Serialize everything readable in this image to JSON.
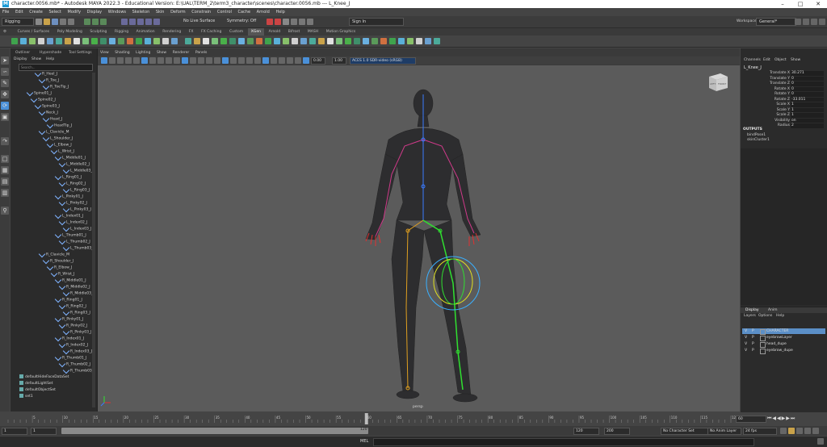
{
  "titlebar": {
    "title": "character.0056.mb* - Autodesk MAYA 2022.3 - Educational Version: E:\\UAL\\TERM_2\\term3_character\\scenes\\character.0056.mb  ---  L_Knee_J",
    "logo": "M"
  },
  "menus": [
    "File",
    "Edit",
    "Create",
    "Select",
    "Modify",
    "Display",
    "Windows",
    "Skeleton",
    "Skin",
    "Deform",
    "Constrain",
    "Control",
    "Cache",
    "Arnold",
    "Help"
  ],
  "status": {
    "menuset": "Rigging",
    "live_surface": "No Live Surface",
    "symmetry": "Symmetry: Off",
    "signin": "Sign In",
    "workspace_label": "Workspace:",
    "workspace": "General*"
  },
  "shelf_tabs": [
    "Curves / Surfaces",
    "Poly Modeling",
    "Sculpting",
    "Rigging",
    "Animation",
    "Rendering",
    "FX",
    "FX Caching",
    "Custom",
    "XGen",
    "Arnold",
    "Bifrost",
    "MASH",
    "Motion Graphics"
  ],
  "shelf_active": "XGen",
  "outliner": {
    "tabs": [
      "Outliner",
      "Hypershade",
      "Tool Settings"
    ],
    "menu": [
      "Display",
      "Show",
      "Help"
    ],
    "search_placeholder": "Search...",
    "nodes": [
      {
        "label": "R_Heel_J",
        "depth": 5
      },
      {
        "label": "R_Toe_J",
        "depth": 6
      },
      {
        "label": "R_ToeTip_J",
        "depth": 7
      },
      {
        "label": "Spine01_J",
        "depth": 3
      },
      {
        "label": "Spine02_J",
        "depth": 4
      },
      {
        "label": "Spine03_J",
        "depth": 5
      },
      {
        "label": "Neck_J",
        "depth": 6
      },
      {
        "label": "Head_J",
        "depth": 7
      },
      {
        "label": "HeadTip_J",
        "depth": 8
      },
      {
        "label": "L_Clavicle_M",
        "depth": 6
      },
      {
        "label": "L_Shoulder_J",
        "depth": 7
      },
      {
        "label": "L_Elbow_J",
        "depth": 8
      },
      {
        "label": "L_Wrist_J",
        "depth": 9
      },
      {
        "label": "L_Middle01_J",
        "depth": 10
      },
      {
        "label": "L_Middle02_J",
        "depth": 11
      },
      {
        "label": "L_Middle03_J",
        "depth": 12
      },
      {
        "label": "L_Ring01_J",
        "depth": 10
      },
      {
        "label": "L_Ring02_J",
        "depth": 11
      },
      {
        "label": "L_Ring03_J",
        "depth": 12
      },
      {
        "label": "L_Pinky01_J",
        "depth": 10
      },
      {
        "label": "L_Pinky02_J",
        "depth": 11
      },
      {
        "label": "L_Pinky03_J",
        "depth": 12
      },
      {
        "label": "L_Index01_J",
        "depth": 10
      },
      {
        "label": "L_Index02_J",
        "depth": 11
      },
      {
        "label": "L_Index03_J",
        "depth": 12
      },
      {
        "label": "L_Thumb01_J",
        "depth": 10
      },
      {
        "label": "L_Thumb02_J",
        "depth": 11
      },
      {
        "label": "L_Thumb03_J",
        "depth": 12
      },
      {
        "label": "R_Clavicle_M",
        "depth": 6
      },
      {
        "label": "R_Shoulder_J",
        "depth": 7
      },
      {
        "label": "R_Elbow_J",
        "depth": 8
      },
      {
        "label": "R_Wrist_J",
        "depth": 9
      },
      {
        "label": "R_Middle01_J",
        "depth": 10
      },
      {
        "label": "R_Middle02_J",
        "depth": 11
      },
      {
        "label": "R_Middle03_J",
        "depth": 12
      },
      {
        "label": "R_Ring01_J",
        "depth": 10
      },
      {
        "label": "R_Ring02_J",
        "depth": 11
      },
      {
        "label": "R_Ring03_J",
        "depth": 12
      },
      {
        "label": "R_Pinky01_J",
        "depth": 10
      },
      {
        "label": "R_Pinky02_J",
        "depth": 11
      },
      {
        "label": "R_Pinky03_J",
        "depth": 12
      },
      {
        "label": "R_Index01_J",
        "depth": 10
      },
      {
        "label": "R_Index02_J",
        "depth": 11
      },
      {
        "label": "R_Index03_J",
        "depth": 12
      },
      {
        "label": "R_Thumb01_J",
        "depth": 10
      },
      {
        "label": "R_Thumb02_J",
        "depth": 11
      },
      {
        "label": "R_Thumb03_J",
        "depth": 12
      },
      {
        "label": "defaultHideFaceDataSet",
        "depth": 1,
        "set": true
      },
      {
        "label": "defaultLightSet",
        "depth": 1,
        "set": true
      },
      {
        "label": "defaultObjectSet",
        "depth": 1,
        "set": true
      },
      {
        "label": "set1",
        "depth": 1,
        "set": true
      }
    ]
  },
  "viewport": {
    "menu": [
      "View",
      "Shading",
      "Lighting",
      "Show",
      "Renderer",
      "Panels"
    ],
    "exposure": "0.00",
    "gamma": "1.00",
    "colorspace": "ACES 1.0 SDR-video (sRGB)",
    "camera_label": "persp",
    "viewcube_left": "LEFT",
    "viewcube_front": "FRONT"
  },
  "channelbox": {
    "tabs": [
      "Channels",
      "Edit",
      "Object",
      "Show"
    ],
    "object": "L_Knee_J",
    "channels": [
      {
        "name": "Translate X",
        "value": "30.271"
      },
      {
        "name": "Translate Y",
        "value": "0"
      },
      {
        "name": "Translate Z",
        "value": "0"
      },
      {
        "name": "Rotate X",
        "value": "0"
      },
      {
        "name": "Rotate Y",
        "value": "0"
      },
      {
        "name": "Rotate Z",
        "value": "-33.011"
      },
      {
        "name": "Scale X",
        "value": "1"
      },
      {
        "name": "Scale Y",
        "value": "1"
      },
      {
        "name": "Scale Z",
        "value": "1"
      },
      {
        "name": "Visibility",
        "value": "on"
      },
      {
        "name": "Radius",
        "value": "2"
      }
    ],
    "outputs_label": "OUTPUTS",
    "outputs": [
      "bindPose1",
      "skinCluster1"
    ]
  },
  "layers": {
    "tabs": [
      "Display",
      "Anim"
    ],
    "menu": [
      "Layers",
      "Options",
      "Help"
    ],
    "items": [
      {
        "v": "V",
        "p": "P",
        "name": "CHARACTER",
        "selected": true
      },
      {
        "v": "V",
        "p": "P",
        "name": "eyebrowLayer",
        "selected": false
      },
      {
        "v": "V",
        "p": "P",
        "name": "head_dupe",
        "selected": false
      },
      {
        "v": "V",
        "p": "P",
        "name": "eyebrow_dupe",
        "selected": false
      }
    ]
  },
  "timeline": {
    "ticks": [
      "5",
      "10",
      "15",
      "20",
      "25",
      "30",
      "35",
      "40",
      "45",
      "50",
      "55",
      "60",
      "65",
      "70",
      "75",
      "80",
      "85",
      "90",
      "95",
      "100",
      "105",
      "110",
      "115",
      "120"
    ],
    "current_frame": "60",
    "start": "1",
    "range_start": "1",
    "range_end": "120",
    "end": "120",
    "max": "200",
    "fps": "24 fps",
    "character_set": "No Character Set",
    "anim_layer": "No Anim Layer"
  },
  "cmdline": {
    "lang": "MEL"
  },
  "colors": {
    "accent": "#4a90d9",
    "viewport_bg": "#5b5b5b",
    "selected_layer": "#5b8fc7"
  }
}
